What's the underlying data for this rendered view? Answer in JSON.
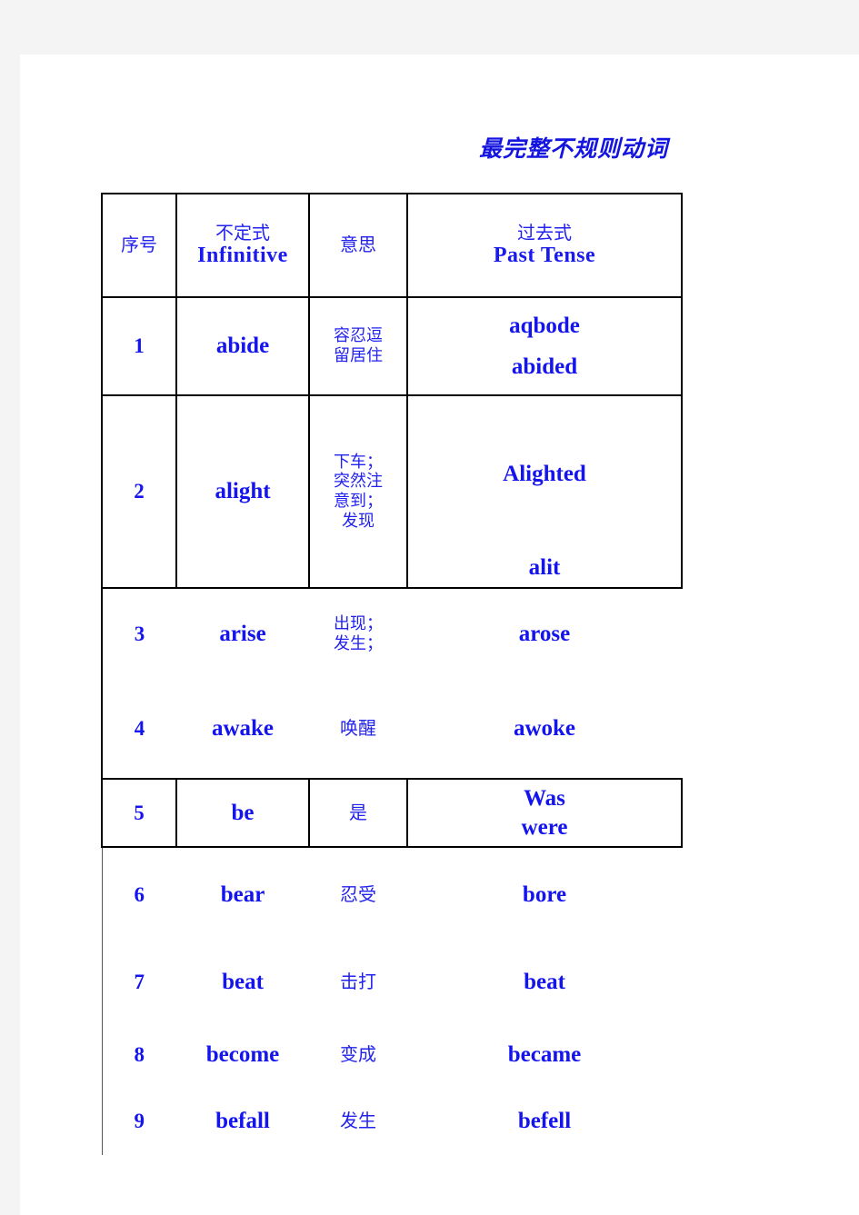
{
  "document": {
    "title": "最完整不规则动词"
  },
  "table": {
    "headers": {
      "no": "序号",
      "infinitive_cn": "不定式",
      "infinitive_en": "Infinitive",
      "meaning": "意思",
      "past_cn": "过去式",
      "past_en": "Past  Tense"
    },
    "rows": [
      {
        "no": "1",
        "infinitive": "abide",
        "meaning_line1": "容忍逗",
        "meaning_line2": "留居住",
        "past_line1": "aqbode",
        "past_line2": "abided"
      },
      {
        "no": "2",
        "infinitive": "alight",
        "meaning_line1": "下车；",
        "meaning_line2": "突然注",
        "meaning_line3": "意到；",
        "meaning_line4": "发现",
        "past_line1": "Alighted",
        "past_line2": "alit"
      },
      {
        "no": "3",
        "infinitive": "arise",
        "meaning_line1": "出现；",
        "meaning_line2": "发生；",
        "past_line1": "arose"
      },
      {
        "no": "4",
        "infinitive": "awake",
        "meaning_line1": "唤醒",
        "past_line1": "awoke"
      },
      {
        "no": "5",
        "infinitive": "be",
        "meaning_line1": "是",
        "past_line1": "Was",
        "past_line2": "were"
      },
      {
        "no": "6",
        "infinitive": "bear",
        "meaning_line1": "忍受",
        "past_line1": "bore"
      },
      {
        "no": "7",
        "infinitive": "beat",
        "meaning_line1": "击打",
        "past_line1": "beat"
      },
      {
        "no": "8",
        "infinitive": "become",
        "meaning_line1": "变成",
        "past_line1": "became"
      },
      {
        "no": "9",
        "infinitive": "befall",
        "meaning_line1": "发生",
        "past_line1": "befell"
      }
    ]
  },
  "colors": {
    "text_blue": "#1414ee",
    "border_black": "#000000",
    "page_background": "#ffffff",
    "canvas_background": "#f4f4f4"
  }
}
